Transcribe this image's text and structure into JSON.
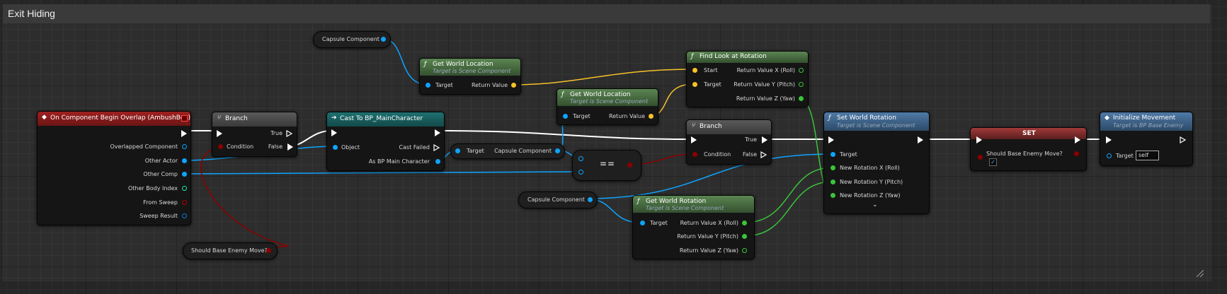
{
  "graph": {
    "title": "Exit Hiding"
  },
  "nodes": {
    "event_overlap": {
      "title": "On Component Begin Overlap (AmbushBox)",
      "pins": [
        "Overlapped Component",
        "Other Actor",
        "Other Comp",
        "Other Body Index",
        "From Sweep",
        "Sweep Result"
      ]
    },
    "branch1": {
      "title": "Branch",
      "true_label": "True",
      "condition_label": "Condition",
      "false_label": "False"
    },
    "cast": {
      "title": "Cast To BP_MainCharacter",
      "object_label": "Object",
      "cast_failed_label": "Cast Failed",
      "as_label": "As BP Main Character"
    },
    "capsule1": {
      "label": "Capsule Component"
    },
    "gwl1": {
      "title": "Get World Location",
      "subtitle": "Target is Scene Component",
      "target_label": "Target",
      "return_label": "Return Value"
    },
    "gwl2": {
      "title": "Get World Location",
      "subtitle": "Target is Scene Component",
      "target_label": "Target",
      "return_label": "Return Value"
    },
    "findlook": {
      "title": "Find Look at Rotation",
      "start_label": "Start",
      "target_label": "Target",
      "rx": "Return Value X (Roll)",
      "ry": "Return Value Y (Pitch)",
      "rz": "Return Value Z (Yaw)"
    },
    "target_capsule": {
      "target_label": "Target",
      "capsule_label": "Capsule Component"
    },
    "equal": {
      "symbol": "=="
    },
    "branch2": {
      "title": "Branch",
      "true_label": "True",
      "condition_label": "Condition",
      "false_label": "False"
    },
    "capsule2": {
      "label": "Capsule Component"
    },
    "gwr": {
      "title": "Get World Rotation",
      "subtitle": "Target is Scene Component",
      "target_label": "Target",
      "rx": "Return Value X (Roll)",
      "ry": "Return Value Y (Pitch)",
      "rz": "Return Value Z (Yaw)"
    },
    "swr": {
      "title": "Set World Rotation",
      "subtitle": "Target is Scene Component",
      "target_label": "Target",
      "nx": "New Rotation X (Roll)",
      "ny": "New Rotation Y (Pitch)",
      "nz": "New Rotation Z (Yaw)"
    },
    "set": {
      "title": "SET",
      "var_label": "Should Base Enemy Move?",
      "checked": true
    },
    "init": {
      "title": "Initialize Movement",
      "subtitle": "Target is BP Base Enemy",
      "target_label": "Target",
      "self_value": "self"
    },
    "var_get": {
      "label": "Should Base Enemy Move?"
    }
  },
  "pin_colors": {
    "exec": "#ffffff",
    "object": "#0da4ff",
    "vector": "#f7c128",
    "float": "#3ac43a",
    "bool": "#8c0000",
    "int": "#1ee6a8",
    "struct": "#0a5ea8"
  },
  "header_colors": {
    "event": "#8a1f1f",
    "flow": "#4a4a4a",
    "cast": "#1d5f5f",
    "pure_function": "#4b6e43",
    "function": "#3c5e82",
    "set": "#7a2b2b"
  }
}
